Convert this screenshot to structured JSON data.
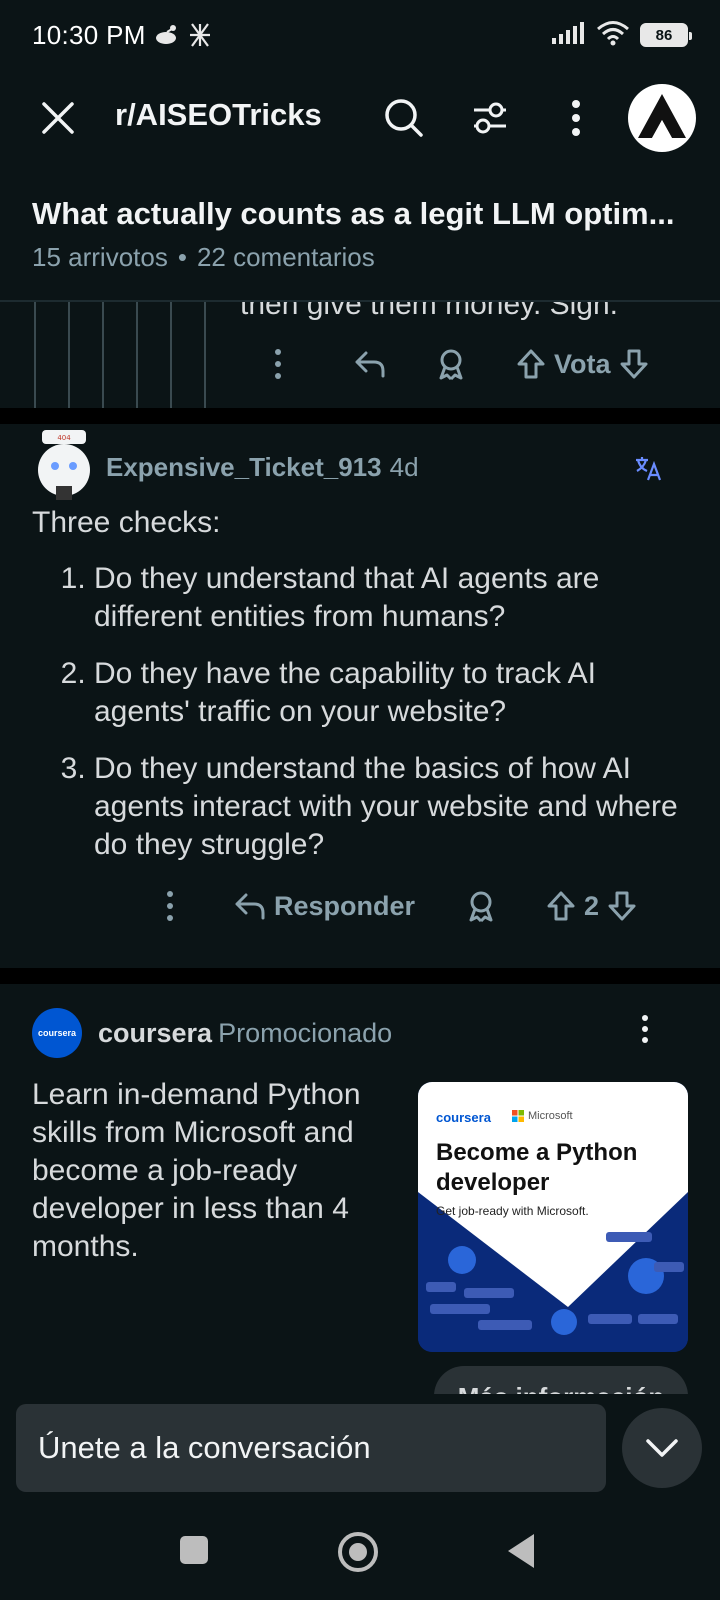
{
  "status_bar": {
    "time": "10:30 PM",
    "battery": "86"
  },
  "header": {
    "subreddit": "r/AISEOTricks"
  },
  "post": {
    "title": "What actually counts as a legit LLM optim...",
    "upvotes": "15 arrivotos",
    "dot": "•",
    "comments": "22 comentarios"
  },
  "previous_comment": {
    "cut_text": "then give them money. Sigh.",
    "vote_label": "Vota"
  },
  "comment": {
    "username": "Expensive_Ticket_913",
    "age": "4d",
    "intro": "Three checks:",
    "items": [
      "Do they understand that AI agents are different entities from humans?",
      "Do they have the capability to track AI agents' traffic on your website?",
      "Do they understand the basics of how AI agents interact with your website and where do they struggle?"
    ],
    "reply_label": "Responder",
    "score": "2"
  },
  "ad": {
    "logo_text": "coursera",
    "brand": "coursera",
    "promoted": "Promocionado",
    "text": "Learn in-demand Python skills from Microsoft and become a job-ready developer in less than 4 months.",
    "image": {
      "brand": "coursera",
      "partner": "Microsoft",
      "headline": "Become a Python developer",
      "subline": "Get job-ready with Microsoft."
    },
    "cta": "Más información"
  },
  "composer": {
    "placeholder": "Únete a la conversación"
  },
  "colors": {
    "background": "#0b1416",
    "muted": "#8ba2ad",
    "text": "#d7dadc",
    "accent_blue": "#0056d2",
    "translate_blue": "#6a8cff"
  }
}
